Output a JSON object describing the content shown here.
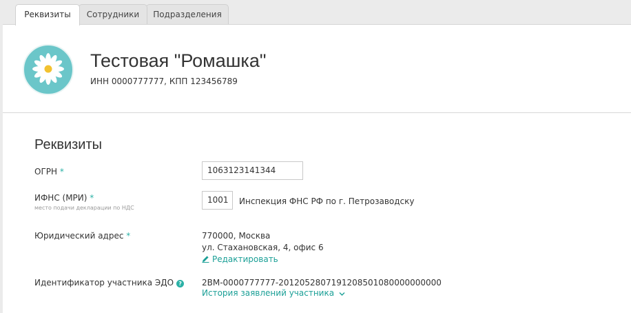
{
  "tabs": [
    {
      "label": "Реквизиты",
      "active": true
    },
    {
      "label": "Сотрудники",
      "active": false
    },
    {
      "label": "Подразделения",
      "active": false
    }
  ],
  "org": {
    "name": "Тестовая \"Ромашка\"",
    "ids": "ИНН 0000777777, КПП 123456789",
    "avatar_icon": "daisy-logo"
  },
  "section": {
    "title": "Реквизиты"
  },
  "fields": {
    "ogrn": {
      "label": "ОГРН",
      "required_mark": "*",
      "value": "1063123141344"
    },
    "ifns": {
      "label": "ИФНС (МРИ)",
      "required_mark": "*",
      "sublabel": "место подачи декларации по НДС",
      "code": "1001",
      "name": "Инспекция ФНС РФ по г. Петрозаводску"
    },
    "address": {
      "label": "Юридический адрес",
      "required_mark": "*",
      "line1": "770000, Москва",
      "line2": "ул. Стахановская, 4, офис 6",
      "edit_link": "Редактировать",
      "edit_icon": "pencil-icon"
    },
    "edo": {
      "label": "Идентификатор участника ЭДО",
      "help_icon": "question-icon",
      "help_glyph": "?",
      "value": "2BM-0000777777-2012052807191208501080000000000",
      "history_link": "История заявлений участника",
      "history_icon": "chevron-down-icon"
    }
  },
  "colors": {
    "accent": "#1a9f96",
    "avatar_bg": "#6bc6c9",
    "required": "#2bb1a6"
  }
}
